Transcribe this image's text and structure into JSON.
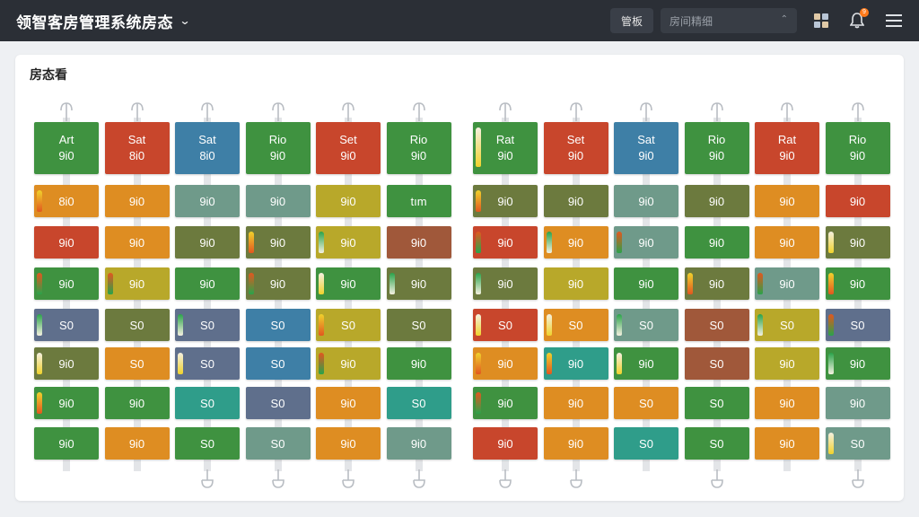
{
  "app": {
    "title": "领智客房管理系统房态"
  },
  "toolbar": {
    "button_label": "管板",
    "select_placeholder": "房间精细"
  },
  "icons": {
    "title_chevron": "chevron-down-icon",
    "select_chevron": "chevron-up-icon",
    "grid": "grid-icon",
    "bell": "bell-icon",
    "menu": "menu-icon"
  },
  "notifications": {
    "count": "9"
  },
  "panel": {
    "title": "房态看"
  },
  "palette": {
    "G": "#3f9240",
    "R": "#c8462c",
    "B": "#3e7fa6",
    "O": "#de8d22",
    "S": "#6f9a8a",
    "D": "#6c7a3e",
    "Y": "#b8a82a",
    "N": "#5f6f8c",
    "T": "#2f9d8a",
    "M": "#a0583a"
  },
  "groups": [
    {
      "columns": [
        {
          "header": {
            "label": "Art",
            "value": "9i0",
            "color": "G"
          },
          "rows": [
            {
              "label": "8i0",
              "color": "O",
              "flame": true
            },
            {
              "label": "9i0",
              "color": "R"
            },
            {
              "label": "9i0",
              "color": "G",
              "flame": true
            },
            {
              "label": "S0",
              "color": "N",
              "flame": true
            },
            {
              "label": "9i0",
              "color": "D",
              "flame": true
            },
            {
              "label": "9i0",
              "color": "G",
              "flame": true
            },
            {
              "label": "9i0",
              "color": "G"
            }
          ]
        },
        {
          "header": {
            "label": "Sat",
            "value": "8i0",
            "color": "R"
          },
          "rows": [
            {
              "label": "9i0",
              "color": "O"
            },
            {
              "label": "9i0",
              "color": "O"
            },
            {
              "label": "9i0",
              "color": "Y",
              "flame": true
            },
            {
              "label": "S0",
              "color": "D"
            },
            {
              "label": "S0",
              "color": "O"
            },
            {
              "label": "9i0",
              "color": "G"
            },
            {
              "label": "9i0",
              "color": "O"
            }
          ]
        },
        {
          "header": {
            "label": "Sat",
            "value": "8i0",
            "color": "B"
          },
          "rows": [
            {
              "label": "9i0",
              "color": "S"
            },
            {
              "label": "9i0",
              "color": "D"
            },
            {
              "label": "9i0",
              "color": "G"
            },
            {
              "label": "S0",
              "color": "N",
              "flame": true
            },
            {
              "label": "S0",
              "color": "N",
              "flame": true
            },
            {
              "label": "S0",
              "color": "T"
            },
            {
              "label": "S0",
              "color": "G"
            }
          ]
        },
        {
          "header": {
            "label": "Rio",
            "value": "9i0",
            "color": "G"
          },
          "rows": [
            {
              "label": "9i0",
              "color": "S"
            },
            {
              "label": "9i0",
              "color": "D",
              "flame": true
            },
            {
              "label": "9i0",
              "color": "D",
              "flame": true
            },
            {
              "label": "S0",
              "color": "B"
            },
            {
              "label": "S0",
              "color": "B"
            },
            {
              "label": "S0",
              "color": "N"
            },
            {
              "label": "S0",
              "color": "S"
            }
          ]
        },
        {
          "header": {
            "label": "Set",
            "value": "9i0",
            "color": "R"
          },
          "rows": [
            {
              "label": "9i0",
              "color": "Y"
            },
            {
              "label": "9i0",
              "color": "Y",
              "flame": true
            },
            {
              "label": "9i0",
              "color": "G",
              "flame": true
            },
            {
              "label": "S0",
              "color": "Y",
              "flame": true
            },
            {
              "label": "9i0",
              "color": "Y",
              "flame": true
            },
            {
              "label": "9i0",
              "color": "O"
            },
            {
              "label": "9i0",
              "color": "O"
            }
          ]
        },
        {
          "header": {
            "label": "Rio",
            "value": "9i0",
            "color": "G"
          },
          "rows": [
            {
              "label": "tım",
              "color": "G"
            },
            {
              "label": "9i0",
              "color": "M"
            },
            {
              "label": "9i0",
              "color": "D",
              "flame": true
            },
            {
              "label": "S0",
              "color": "D"
            },
            {
              "label": "9i0",
              "color": "G"
            },
            {
              "label": "S0",
              "color": "T"
            },
            {
              "label": "9i0",
              "color": "S"
            }
          ]
        }
      ]
    },
    {
      "columns": [
        {
          "header": {
            "label": "Rat",
            "value": "9i0",
            "color": "G",
            "flame": true
          },
          "rows": [
            {
              "label": "9i0",
              "color": "D",
              "flame": true
            },
            {
              "label": "9i0",
              "color": "R",
              "flame": true
            },
            {
              "label": "9i0",
              "color": "D",
              "flame": true
            },
            {
              "label": "S0",
              "color": "R",
              "flame": true
            },
            {
              "label": "9i0",
              "color": "O",
              "flame": true
            },
            {
              "label": "9i0",
              "color": "G",
              "flame": true
            },
            {
              "label": "9i0",
              "color": "R"
            }
          ]
        },
        {
          "header": {
            "label": "Set",
            "value": "9i0",
            "color": "R"
          },
          "rows": [
            {
              "label": "9i0",
              "color": "D"
            },
            {
              "label": "9i0",
              "color": "O",
              "flame": true
            },
            {
              "label": "9i0",
              "color": "Y"
            },
            {
              "label": "S0",
              "color": "O",
              "flame": true
            },
            {
              "label": "9i0",
              "color": "T",
              "flame": true
            },
            {
              "label": "9i0",
              "color": "O"
            },
            {
              "label": "9i0",
              "color": "O"
            }
          ]
        },
        {
          "header": {
            "label": "Sat",
            "value": "9i0",
            "color": "B"
          },
          "rows": [
            {
              "label": "9i0",
              "color": "S"
            },
            {
              "label": "9i0",
              "color": "S",
              "flame": true
            },
            {
              "label": "9i0",
              "color": "G"
            },
            {
              "label": "S0",
              "color": "S",
              "flame": true
            },
            {
              "label": "9i0",
              "color": "G",
              "flame": true
            },
            {
              "label": "S0",
              "color": "O"
            },
            {
              "label": "S0",
              "color": "T"
            }
          ]
        },
        {
          "header": {
            "label": "Rio",
            "value": "9i0",
            "color": "G"
          },
          "rows": [
            {
              "label": "9i0",
              "color": "D"
            },
            {
              "label": "9i0",
              "color": "G"
            },
            {
              "label": "9i0",
              "color": "D",
              "flame": true
            },
            {
              "label": "S0",
              "color": "M"
            },
            {
              "label": "S0",
              "color": "M"
            },
            {
              "label": "S0",
              "color": "G"
            },
            {
              "label": "S0",
              "color": "G"
            }
          ]
        },
        {
          "header": {
            "label": "Rat",
            "value": "9i0",
            "color": "R"
          },
          "rows": [
            {
              "label": "9i0",
              "color": "O"
            },
            {
              "label": "9i0",
              "color": "O"
            },
            {
              "label": "9i0",
              "color": "S",
              "flame": true
            },
            {
              "label": "S0",
              "color": "Y",
              "flame": true
            },
            {
              "label": "9i0",
              "color": "Y"
            },
            {
              "label": "9i0",
              "color": "O"
            },
            {
              "label": "9i0",
              "color": "O"
            }
          ]
        },
        {
          "header": {
            "label": "Rio",
            "value": "9i0",
            "color": "G"
          },
          "rows": [
            {
              "label": "9i0",
              "color": "R"
            },
            {
              "label": "9i0",
              "color": "D",
              "flame": true
            },
            {
              "label": "9i0",
              "color": "G",
              "flame": true
            },
            {
              "label": "S0",
              "color": "N",
              "flame": true
            },
            {
              "label": "9i0",
              "color": "G",
              "flame": true
            },
            {
              "label": "9i0",
              "color": "S"
            },
            {
              "label": "S0",
              "color": "S",
              "flame": true
            }
          ]
        }
      ]
    }
  ]
}
